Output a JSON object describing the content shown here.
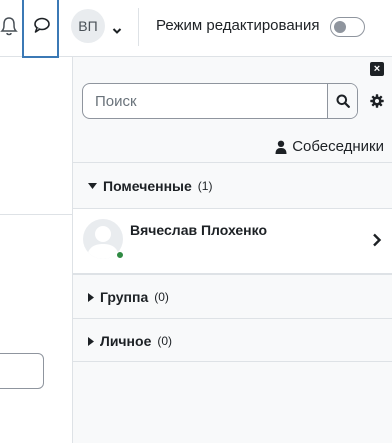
{
  "navbar": {
    "avatar_initials": "ВП",
    "edit_mode_label": "Режим редактирования",
    "edit_mode_on": false
  },
  "drawer": {
    "close_glyph": "×",
    "search": {
      "placeholder": "Поиск",
      "value": ""
    },
    "contacts_label": "Собеседники",
    "sections": {
      "starred": {
        "title": "Помеченные",
        "count": "(1)",
        "expanded": true
      },
      "group": {
        "title": "Группа",
        "count": "(0)",
        "expanded": false
      },
      "private": {
        "title": "Личное",
        "count": "(0)",
        "expanded": false
      }
    },
    "conversations": [
      {
        "name": "Вячеслав Плохенко",
        "online": true
      }
    ]
  },
  "colors": {
    "accent": "#3b79b5",
    "online": "#2f8a43",
    "text": "#1d2125",
    "border": "#dee2e6",
    "drawer_bg": "#f8f9fa"
  },
  "icons": [
    "bell-icon",
    "message-icon",
    "chevron-down-icon",
    "close-icon",
    "search-icon",
    "gear-icon",
    "user-icon",
    "caret-down-icon",
    "caret-right-icon",
    "chevron-right-icon"
  ]
}
